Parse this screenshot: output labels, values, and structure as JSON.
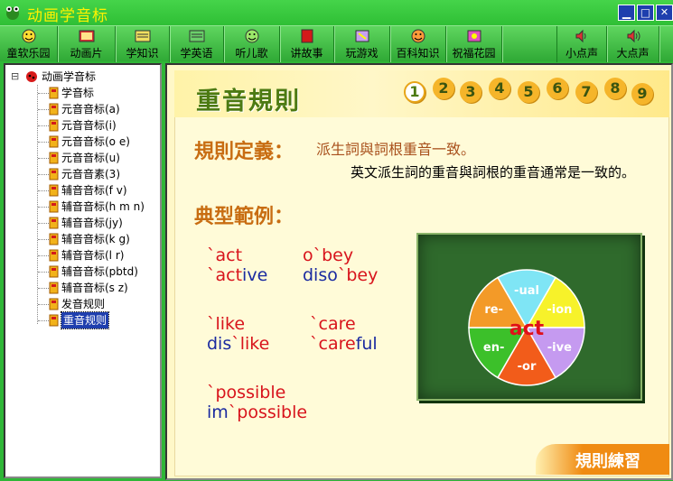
{
  "window": {
    "title": "动画学音标",
    "minimize": "▁",
    "maximize": "□",
    "close": "✕"
  },
  "toolbar": [
    {
      "label": "童软乐园",
      "icon": "smiley-icon"
    },
    {
      "label": "动画片",
      "icon": "film-icon"
    },
    {
      "label": "学知识",
      "icon": "book-icon"
    },
    {
      "label": "学英语",
      "icon": "abc-icon"
    },
    {
      "label": "听儿歌",
      "icon": "smiley-icon"
    },
    {
      "label": "讲故事",
      "icon": "book-red-icon"
    },
    {
      "label": "玩游戏",
      "icon": "game-icon"
    },
    {
      "label": "百科知识",
      "icon": "smiley-icon"
    },
    {
      "label": "祝福花园",
      "icon": "flower-icon"
    },
    {
      "label": "小点声",
      "icon": "speaker-low-icon"
    },
    {
      "label": "大点声",
      "icon": "speaker-high-icon"
    }
  ],
  "tree": {
    "expander": "⊟",
    "root": "动画学音标",
    "items": [
      "学音标",
      "元音音标(a)",
      "元音音标(i)",
      "元音音标(o e)",
      "元音音标(u)",
      "元音音素(3)",
      "辅音音标(f v)",
      "辅音音标(h m n)",
      "辅音音标(jy)",
      "辅音音标(k g)",
      "辅音音标(l r)",
      "辅音音标(pbtd)",
      "辅音音标(s z)",
      "发音规则",
      "重音规则"
    ],
    "selected": "重音规则"
  },
  "lesson": {
    "title": "重音規則",
    "pages": [
      "1",
      "2",
      "3",
      "4",
      "5",
      "6",
      "7",
      "8",
      "9"
    ],
    "active_page": "1",
    "definition_heading": "規則定義：",
    "definition": "派生詞與詞根重音一致。",
    "definition_detail": "英文派生詞的重音與詞根的重音通常是一致的。",
    "examples_heading": "典型範例：",
    "examples": [
      {
        "root_red": "`act",
        "derived_red": "`act",
        "derived_blue": "ive"
      },
      {
        "root_red": "o`bey",
        "derived_blue": "diso",
        "derived_red": "`bey"
      },
      {
        "root_red": "`like",
        "derived_blue": "dis",
        "derived_red": "`like"
      },
      {
        "root_red": "`care",
        "derived_red": "`care",
        "derived_blue": "ful"
      },
      {
        "root_red": "`possible",
        "derived_blue": "im",
        "derived_red": "`possible"
      }
    ],
    "wheel": {
      "center": "act",
      "segments": [
        "-ual",
        "-ion",
        "-ive",
        "-or",
        "en-",
        "re-"
      ],
      "colors": [
        "#7fe5f5",
        "#f7f22a",
        "#c59af0",
        "#f25c1a",
        "#3cc02a",
        "#f39a28"
      ]
    },
    "practice_label": "規則練習"
  }
}
